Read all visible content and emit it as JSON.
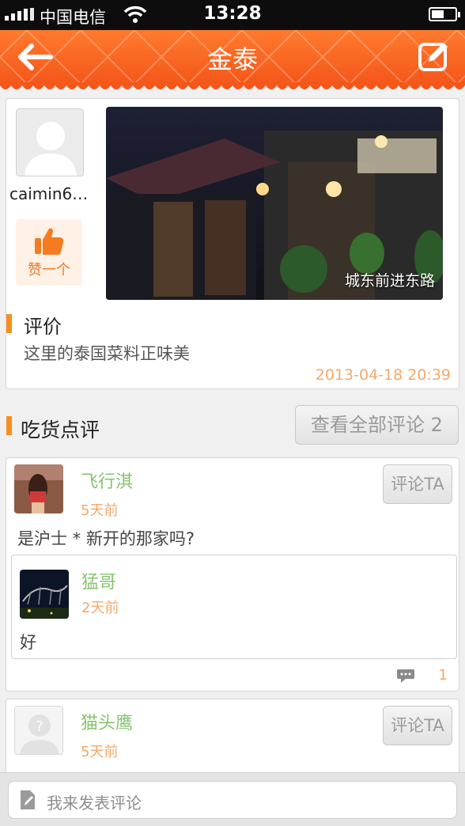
{
  "status_bar": {
    "carrier": "中国电信",
    "time": "13:28"
  },
  "nav": {
    "title": "金泰",
    "back_icon": "back-arrow-icon",
    "edit_icon": "edit-icon"
  },
  "post": {
    "username": "caimin6…",
    "like_label": "赞一个",
    "photo_caption": "城东前进东路",
    "review_heading": "评价",
    "review_text": "这里的泰国菜料正味美",
    "timestamp": "2013-04-18 20:39"
  },
  "comments_section": {
    "title": "吃货点评",
    "view_all_label": "查看全部评论 2"
  },
  "comments": [
    {
      "name": "飞行淇",
      "time": "5天前",
      "reply_label": "评论TA",
      "text": "是沪士 * 新开的那家吗?",
      "replies": [
        {
          "name": "猛哥",
          "time": "2天前",
          "text": "好"
        }
      ],
      "reply_count": "1"
    },
    {
      "name": "猫头鹰",
      "time": "5天前",
      "reply_label": "评论TA"
    }
  ],
  "bottom_bar": {
    "placeholder": "我来发表评论"
  },
  "colors": {
    "nav_orange": "#f4571a",
    "accent_orange": "#f98d1d",
    "name_green": "#87c36e",
    "time_orange": "#f6a86a"
  }
}
